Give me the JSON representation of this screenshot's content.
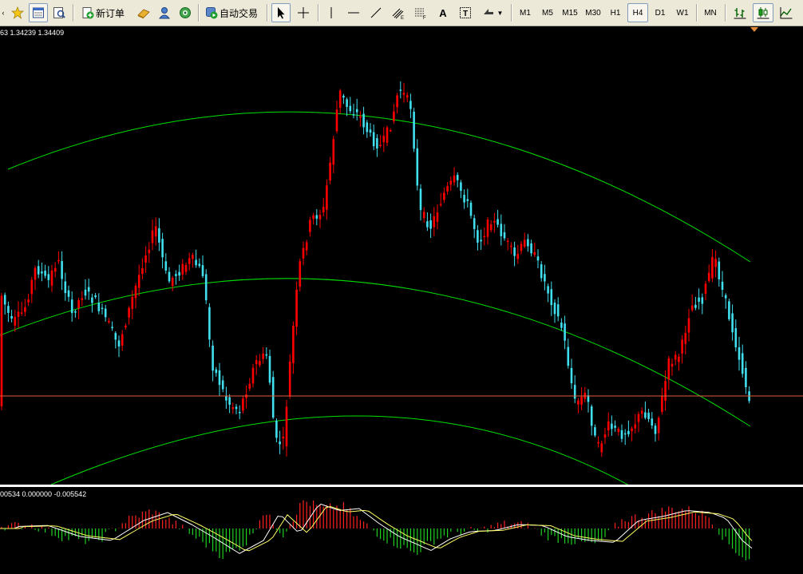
{
  "toolbar": {
    "new_order_label": "新订单",
    "auto_trading_label": "自动交易",
    "text_tool_label": "A",
    "timeframes": [
      "M1",
      "M5",
      "M15",
      "M30",
      "H1",
      "H4",
      "D1",
      "W1",
      "MN"
    ],
    "active_timeframe": "H4"
  },
  "main_chart": {
    "label": "63 1.34239 1.34409",
    "hline_color": "#E0603A",
    "band_color": "#00E000",
    "bull_color": "#FF0000",
    "bear_color": "#40E0F0"
  },
  "sub_chart": {
    "label": "00534 0.000000 -0.005542",
    "pos_color": "#FF2020",
    "neg_color": "#20D020",
    "line1_color": "#FFFFFF",
    "line2_color": "#FFFF66"
  },
  "icons": {
    "arrow": "cursor-arrow-icon",
    "crosshair": "crosshair-icon"
  }
}
